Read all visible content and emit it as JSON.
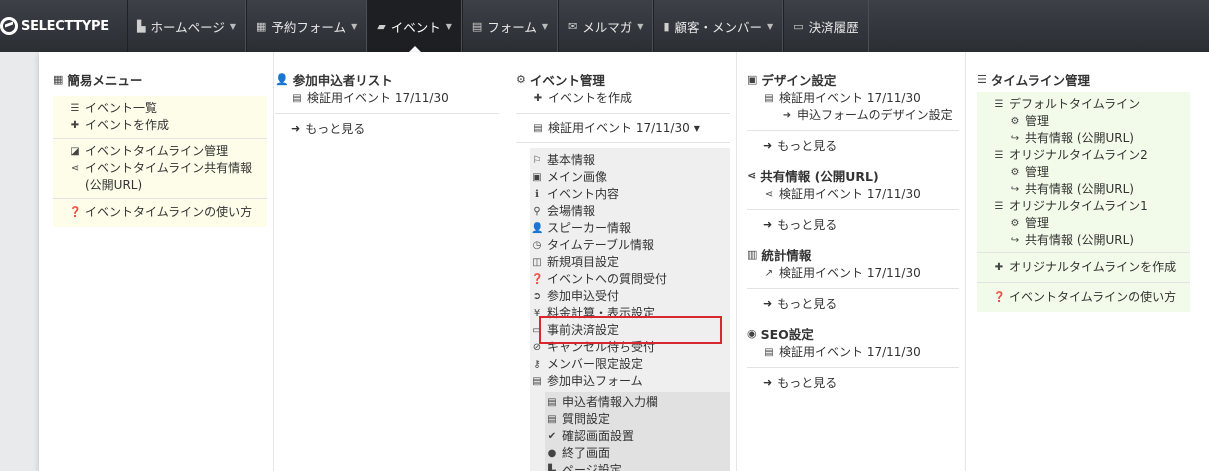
{
  "brand": {
    "name": "SELECTTYPE"
  },
  "nav": [
    {
      "label": "ホームページ",
      "icon": "file-icon",
      "glyph": "▙"
    },
    {
      "label": "予約フォーム",
      "icon": "calendar-icon",
      "glyph": "▦"
    },
    {
      "label": "イベント",
      "icon": "comment-icon",
      "glyph": "▰"
    },
    {
      "label": "フォーム",
      "icon": "list-alt-icon",
      "glyph": "▤"
    },
    {
      "label": "メルマガ",
      "icon": "envelope-icon",
      "glyph": "✉"
    },
    {
      "label": "顧客・メンバー",
      "icon": "book-icon",
      "glyph": "▮"
    },
    {
      "label": "決済履歴",
      "icon": "credit-card-icon",
      "glyph": "▭"
    }
  ],
  "simple_menu": {
    "title": "簡易メニュー",
    "items_a": [
      "イベント一覧",
      "イベントを作成"
    ],
    "items_b": [
      "イベントタイムライン管理",
      "イベントタイムライン共有情報",
      "(公開URL)"
    ],
    "items_c": [
      "イベントタイムラインの使い方"
    ]
  },
  "participants": {
    "title": "参加申込者リスト",
    "event": "検証用イベント 17/11/30",
    "more": "もっと見る"
  },
  "event_mgmt": {
    "title": "イベント管理",
    "create": "イベントを作成",
    "event_toggle": "検証用イベント 17/11/30",
    "settings": [
      "基本情報",
      "メイン画像",
      "イベント内容",
      "会場情報",
      "スピーカー情報",
      "タイムテーブル情報",
      "新規項目設定",
      "イベントへの質問受付",
      "参加申込受付",
      "料金計算・表示設定",
      "事前決済設定",
      "キャンセル待ち受付",
      "メンバー限定設定",
      "参加申込フォーム"
    ],
    "form_settings": [
      "申込者情報入力欄",
      "質問設定",
      "確認画面設置",
      "終了画面",
      "ページ設定"
    ]
  },
  "design": {
    "title": "デザイン設定",
    "event": "検証用イベント 17/11/30",
    "sub": "申込フォームのデザイン設定",
    "more": "もっと見る"
  },
  "share": {
    "title": "共有情報 (公開URL)",
    "event": "検証用イベント 17/11/30",
    "more": "もっと見る"
  },
  "stats": {
    "title": "統計情報",
    "event": "検証用イベント 17/11/30",
    "more": "もっと見る"
  },
  "seo": {
    "title": "SEO設定",
    "event": "検証用イベント 17/11/30",
    "more": "もっと見る"
  },
  "timeline": {
    "title": "タイムライン管理",
    "default_tl": "デフォルトタイムライン",
    "orig2": "オリジナルタイムライン2",
    "orig1": "オリジナルタイムライン1",
    "manage": "管理",
    "share": "共有情報 (公開URL)",
    "create": "オリジナルタイムラインを作成",
    "howto": "イベントタイムラインの使い方"
  },
  "colors": {
    "navbar": "#2b2e33",
    "highlight": "#d8282f",
    "yellow_box": "#fdfdea",
    "green_box": "#f2fbe9"
  }
}
